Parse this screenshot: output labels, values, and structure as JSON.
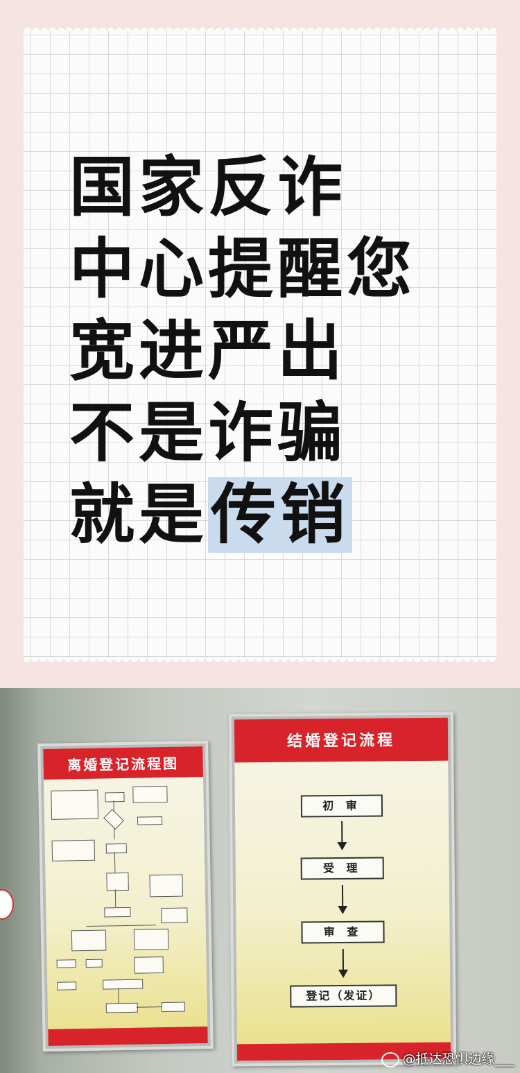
{
  "slogan": {
    "line1": "国家反诈",
    "line2": "中心提醒您",
    "line3": "宽进严出",
    "line4": "不是诈骗",
    "line5_plain": "就是",
    "line5_highlight": "传销"
  },
  "poster_left": {
    "title": "离婚登记流程图"
  },
  "poster_right": {
    "title": "结婚登记流程",
    "steps": [
      "初 审",
      "受 理",
      "审 查",
      "登记（发证）"
    ]
  },
  "watermark": "@抵达恐惧边缘___",
  "colors": {
    "poster_red": "#d8232a",
    "highlight": "#c9dbec",
    "text": "#111111"
  }
}
